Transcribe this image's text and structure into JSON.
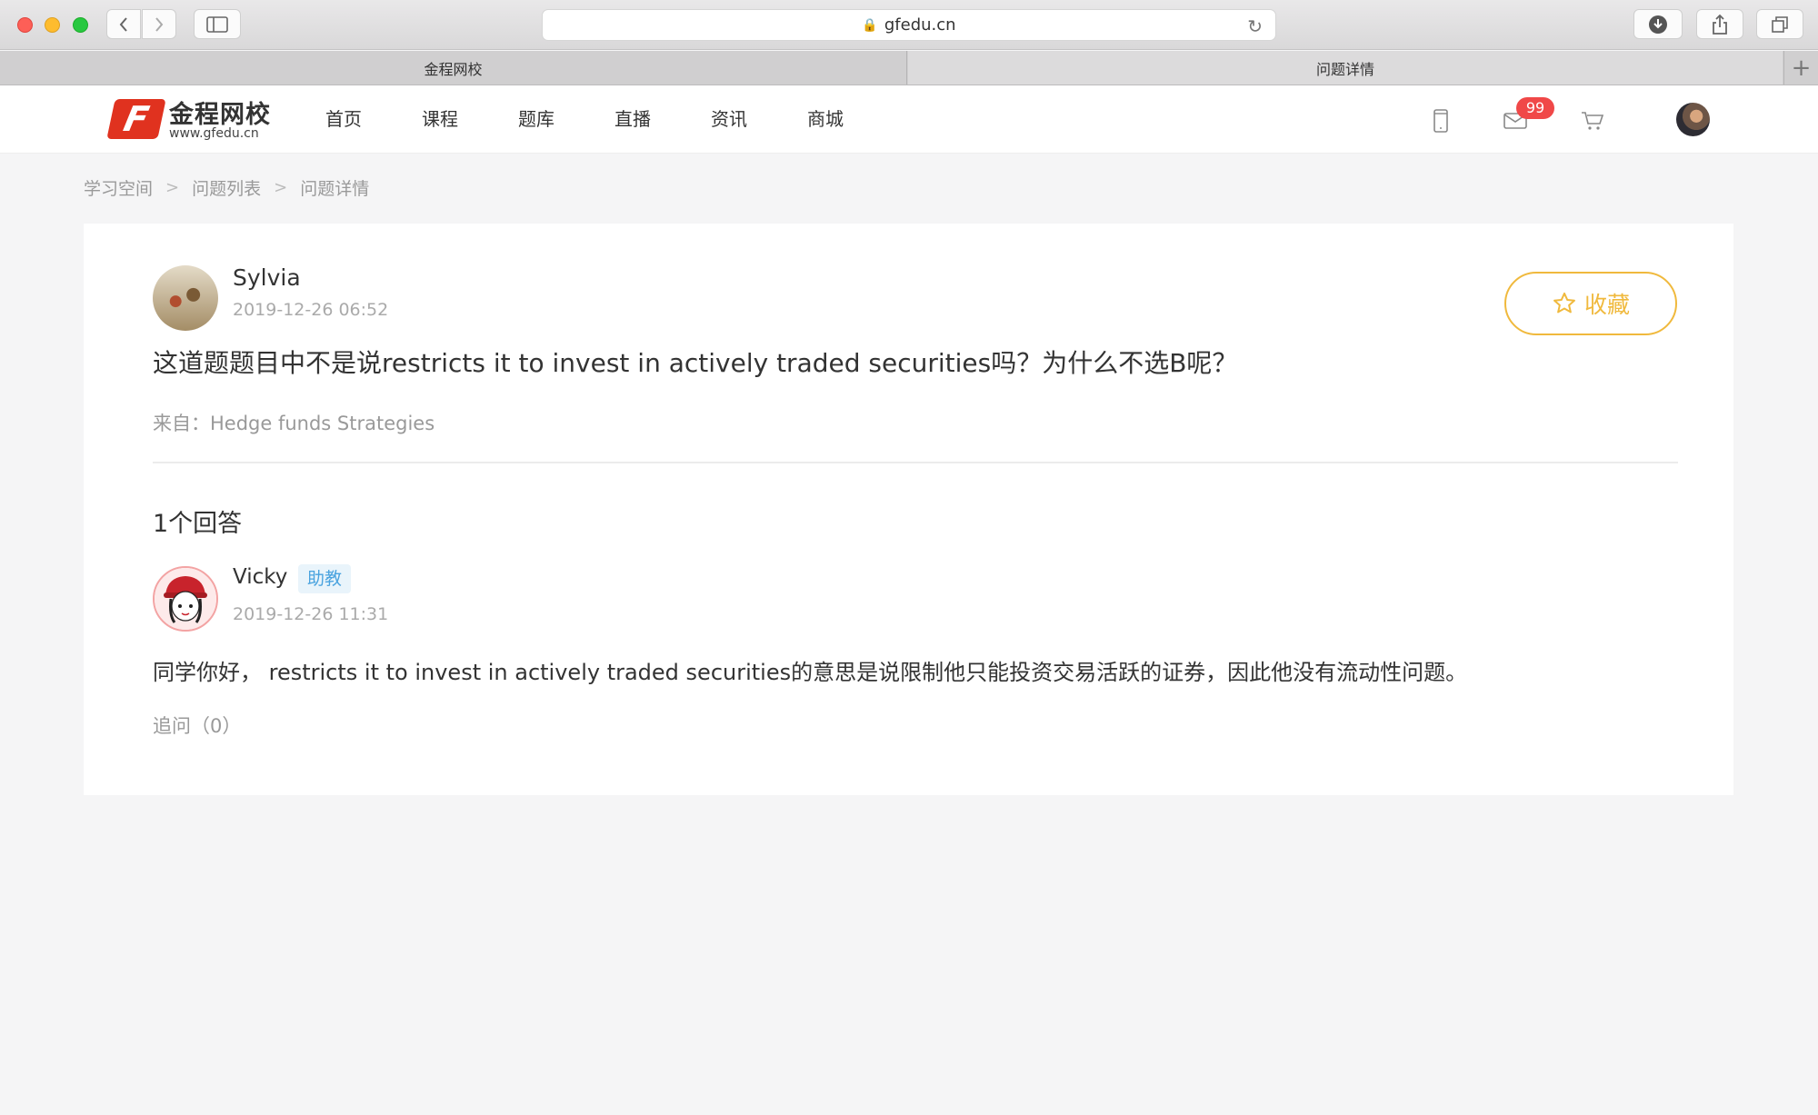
{
  "browser": {
    "url": "gfedu.cn",
    "tabs": [
      {
        "label": "金程网校"
      },
      {
        "label": "问题详情"
      }
    ],
    "new_tab": "+"
  },
  "header": {
    "logo_name": "金程网校",
    "logo_url": "www.gfedu.cn",
    "logo_mark": "F",
    "nav": [
      "首页",
      "课程",
      "题库",
      "直播",
      "资讯",
      "商城"
    ],
    "mail_badge": "99"
  },
  "breadcrumb": [
    "学习空间",
    "问题列表",
    "问题详情"
  ],
  "question": {
    "user": "Sylvia",
    "time": "2019-12-26 06:52",
    "text": "这道题题目中不是说restricts it to invest in actively traded securities吗？为什么不选B呢？",
    "source": "来自：Hedge funds Strategies",
    "favorite_label": "收藏"
  },
  "answers": {
    "count_label": "1个回答",
    "items": [
      {
        "user": "Vicky",
        "role": "助教",
        "time": "2019-12-26 11:31",
        "text": "同学你好，  restricts it to invest in actively traded securities的意思是说限制他只能投资交易活跃的证券，因此他没有流动性问题。",
        "followup": "追问（0）"
      }
    ]
  },
  "colors": {
    "accent": "#f0b93d",
    "badge": "#f04848",
    "logo": "#e0321f",
    "role_tag": "#4aa3df"
  }
}
